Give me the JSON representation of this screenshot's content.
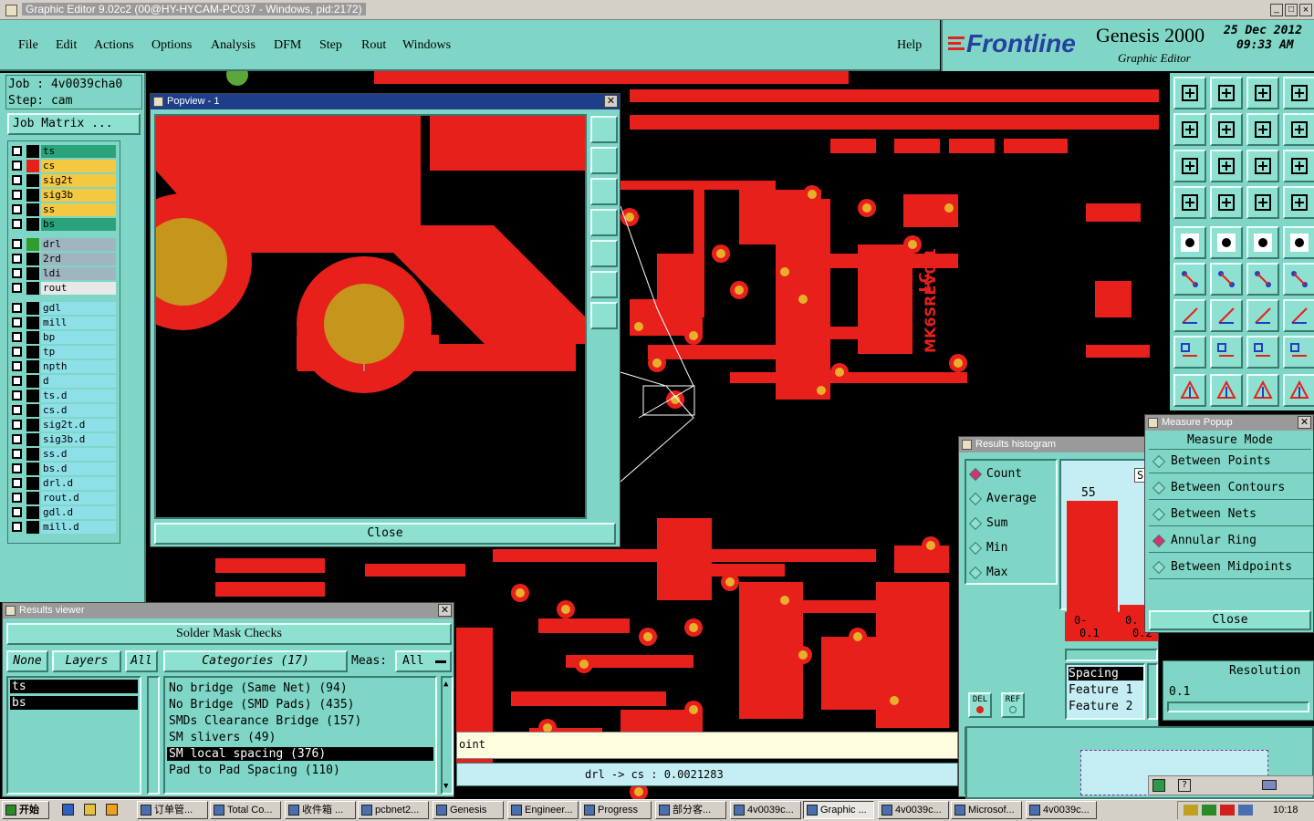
{
  "window": {
    "title": "Graphic Editor 9.02c2 (00@HY-HYCAM-PC037 - Windows, pid:2172)",
    "controls": [
      "_",
      "□",
      "×"
    ]
  },
  "menu": [
    "File",
    "Edit",
    "Actions",
    "Options",
    "Analysis",
    "DFM",
    "Step",
    "Rout",
    "Windows"
  ],
  "help_label": "Help",
  "brand": {
    "logo": "Frontline",
    "product": "Genesis 2000",
    "subtitle": "Graphic Editor",
    "date": "25 Dec 2012",
    "time": "09:33 AM"
  },
  "job": {
    "job_line": "Job : 4v0039cha0",
    "step_line": "Step: cam",
    "matrix_button": "Job Matrix ..."
  },
  "layers": [
    {
      "name": "ts",
      "color": "#2aa37a",
      "swatch": "#000000"
    },
    {
      "name": "cs",
      "color": "#f5c842",
      "swatch": "#e8201c"
    },
    {
      "name": "sig2t",
      "color": "#f5c842",
      "swatch": "#000000"
    },
    {
      "name": "sig3b",
      "color": "#f5c842",
      "swatch": "#000000"
    },
    {
      "name": "ss",
      "color": "#f5c842",
      "swatch": "#000000"
    },
    {
      "name": "bs",
      "color": "#2aa37a",
      "swatch": "#000000"
    },
    {
      "name": "drl",
      "color": "#9fb6c0",
      "swatch": "#2f9e2f"
    },
    {
      "name": "2rd",
      "color": "#9fb6c0",
      "swatch": "#000000"
    },
    {
      "name": "ldi",
      "color": "#9fb6c0",
      "swatch": "#000000"
    },
    {
      "name": "rout",
      "color": "#e8e8e8",
      "swatch": "#000000"
    },
    {
      "name": "gdl",
      "color": "#8ee0e8",
      "swatch": "#000000"
    },
    {
      "name": "mill",
      "color": "#8ee0e8",
      "swatch": "#000000"
    },
    {
      "name": "bp",
      "color": "#8ee0e8",
      "swatch": "#000000"
    },
    {
      "name": "tp",
      "color": "#8ee0e8",
      "swatch": "#000000"
    },
    {
      "name": "npth",
      "color": "#8ee0e8",
      "swatch": "#000000"
    },
    {
      "name": "d",
      "color": "#8ee0e8",
      "swatch": "#000000"
    },
    {
      "name": "ts.d",
      "color": "#8ee0e8",
      "swatch": "#000000"
    },
    {
      "name": "cs.d",
      "color": "#8ee0e8",
      "swatch": "#000000"
    },
    {
      "name": "sig2t.d",
      "color": "#8ee0e8",
      "swatch": "#000000"
    },
    {
      "name": "sig3b.d",
      "color": "#8ee0e8",
      "swatch": "#000000"
    },
    {
      "name": "ss.d",
      "color": "#8ee0e8",
      "swatch": "#000000"
    },
    {
      "name": "bs.d",
      "color": "#8ee0e8",
      "swatch": "#000000"
    },
    {
      "name": "drl.d",
      "color": "#8ee0e8",
      "swatch": "#000000"
    },
    {
      "name": "rout.d",
      "color": "#8ee0e8",
      "swatch": "#000000"
    },
    {
      "name": "gdl.d",
      "color": "#8ee0e8",
      "swatch": "#000000"
    },
    {
      "name": "mill.d",
      "color": "#8ee0e8",
      "swatch": "#000000"
    }
  ],
  "popview": {
    "title": "Popview - 1",
    "close_label": "Close"
  },
  "results_viewer": {
    "title": "Results viewer",
    "header": "Solder Mask Checks",
    "btn_none": "None",
    "btn_layers": "Layers",
    "btn_all": "All",
    "categories_label": "Categories (17)",
    "meas_label": "Meas:",
    "meas_value": "All",
    "layers": [
      "ts",
      "bs"
    ],
    "checks": [
      "No bridge (Same Net) (94)",
      "No Bridge (SMD Pads) (435)",
      "SMDs Clearance Bridge (157)",
      "SM slivers (49)",
      "SM local spacing (376)",
      "Pad to Pad Spacing (110)"
    ],
    "selected_check": "SM local spacing (376)"
  },
  "info_bar": {
    "point_text": "oint",
    "measure_text": "drl -> cs : 0.0021283"
  },
  "histogram": {
    "title": "Results histogram",
    "modes": [
      "Count",
      "Average",
      "Sum",
      "Min",
      "Max"
    ],
    "selected_mode": "Count",
    "bar_value": "55",
    "bin_labels": [
      "0-",
      "0.1",
      "0.",
      "0.2"
    ],
    "del_label": "DEL",
    "ref_label": "REF",
    "spacing_label": "Spacing",
    "feature1": "Feature 1",
    "feature2": "Feature 2",
    "resolution_label": "Resolution",
    "resolution_value": "0.1",
    "s_label": "S"
  },
  "measure_popup": {
    "title": "Measure Popup",
    "header": "Measure Mode",
    "modes": [
      "Between Points",
      "Between Contours",
      "Between Nets",
      "Annular Ring",
      "Between Midpoints"
    ],
    "selected": "Annular Ring",
    "close_label": "Close"
  },
  "pcb_text": [
    "LC",
    "MK6SREV0.1"
  ],
  "taskbar": {
    "start": "开始",
    "items": [
      "订单管...",
      "Total Co...",
      "收件箱 ...",
      "pcbnet2...",
      "Genesis",
      "Engineer...",
      "Progress",
      "部分客...",
      "4v0039c...",
      "Graphic ...",
      "4v0039c...",
      "Microsof...",
      "4v0039c..."
    ],
    "active": "Graphic ...",
    "clock": "10:18"
  }
}
